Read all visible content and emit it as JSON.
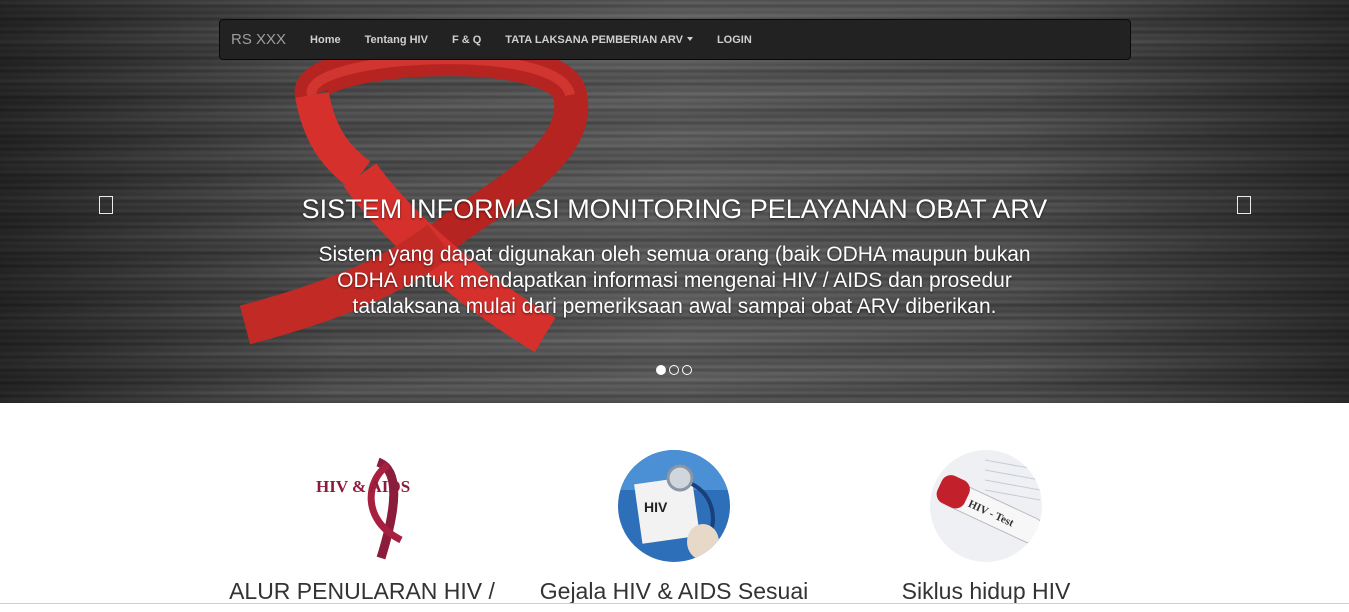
{
  "navbar": {
    "brand": "RS XXX",
    "items": [
      {
        "label": "Home"
      },
      {
        "label": "Tentang HIV"
      },
      {
        "label": "F & Q"
      },
      {
        "label": "TATA LAKSANA PEMBERIAN ARV"
      },
      {
        "label": "LOGIN"
      }
    ]
  },
  "carousel": {
    "title": "SISTEM INFORMASI MONITORING PELAYANAN OBAT ARV",
    "text": "Sistem yang dapat digunakan oleh semua orang (baik ODHA maupun bukan ODHA untuk mendapatkan informasi mengenai HIV / AIDS dan prosedur tatalaksana mulai dari pemeriksaan awal sampai obat ARV diberikan.",
    "slide_count": 3,
    "active_slide": 1,
    "prev_icon": "chevron-left-icon",
    "next_icon": "chevron-right-icon"
  },
  "features": [
    {
      "title": "ALUR PENULARAN HIV /",
      "image_text": "HIV & AIDS"
    },
    {
      "title": "Gejala HIV & AIDS Sesuai",
      "image_text": "HIV"
    },
    {
      "title": "Siklus hidup HIV",
      "image_text": "HIV - Test"
    }
  ],
  "colors": {
    "navbar_bg": "#222222",
    "ribbon": "#d6302c",
    "text_dark": "#333333"
  }
}
